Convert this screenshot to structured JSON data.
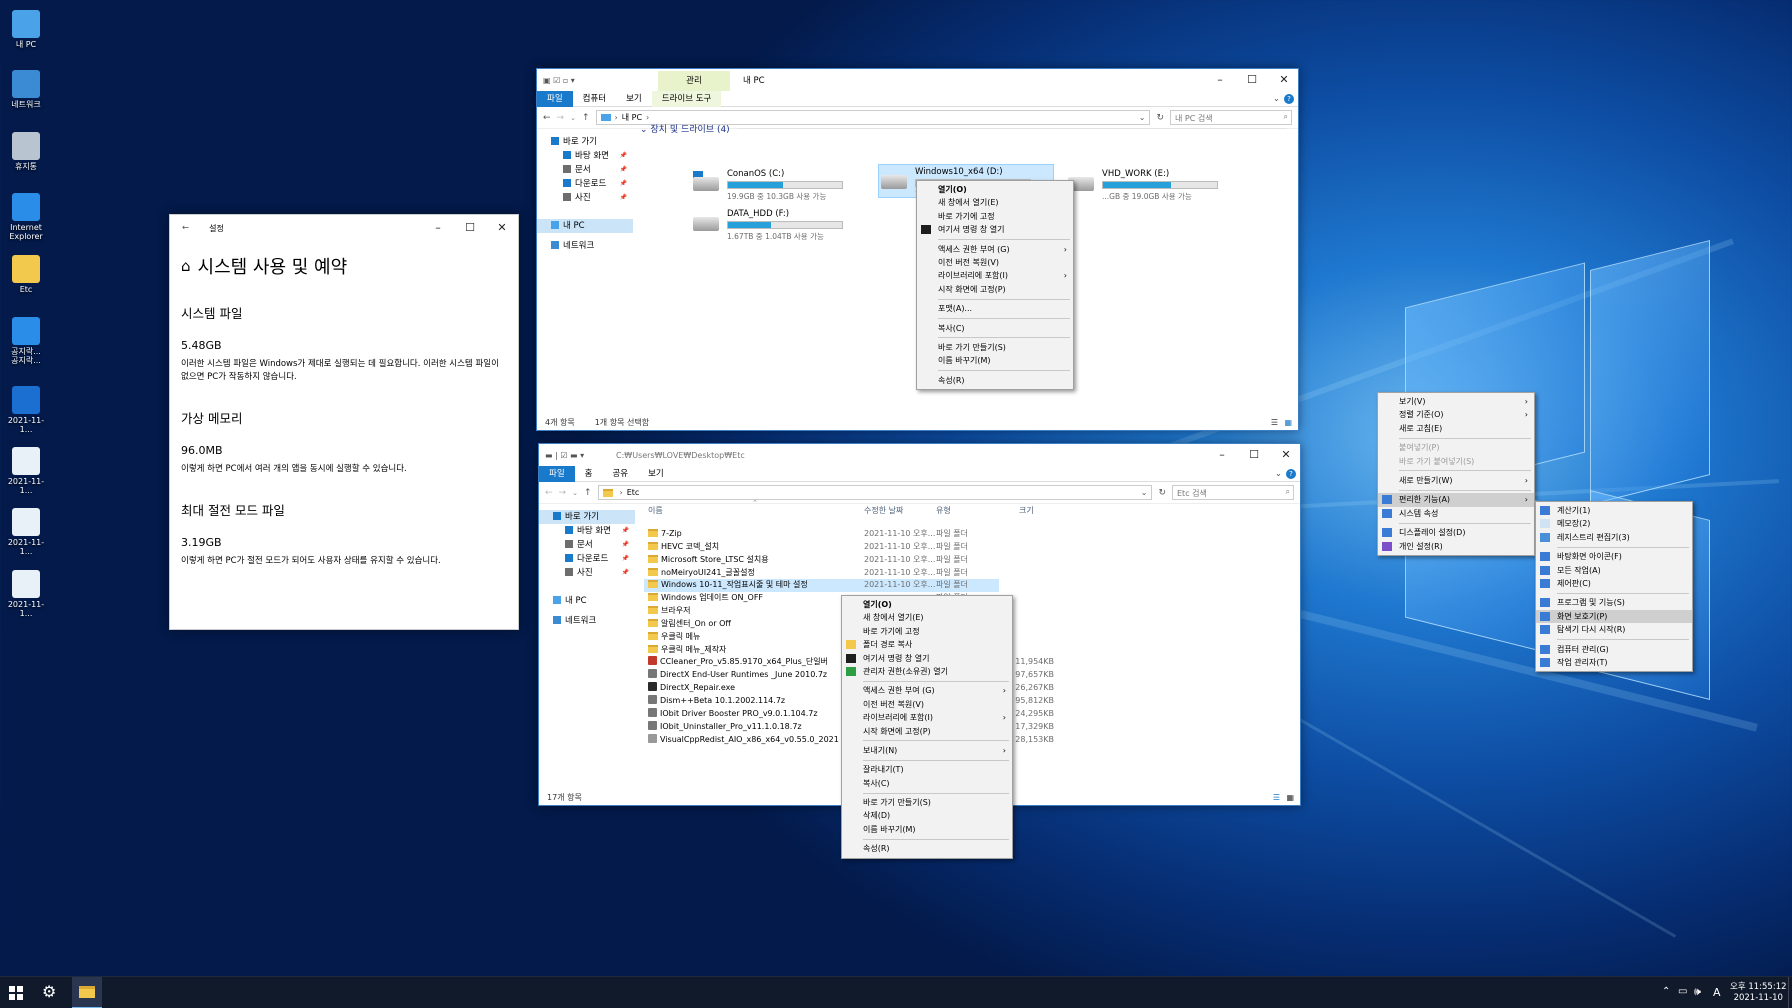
{
  "desktop": {
    "icons": [
      {
        "label": "내 PC",
        "color": "#4aa3e8"
      },
      {
        "label": "네트워크",
        "color": "#3a8ad4"
      },
      {
        "label": "휴지통",
        "color": "#b8c4d0"
      },
      {
        "label": "Internet Explorer",
        "color": "#2a8ee8"
      },
      {
        "label": "Etc",
        "color": "#f2c94c"
      },
      {
        "label": "공지락...\n공지락...",
        "color": "#2a8ee8"
      },
      {
        "label": "2021-11-1...",
        "color": "#1a6fd0"
      },
      {
        "label": "2021-11-1...",
        "color": "#e8f0f8"
      },
      {
        "label": "2021-11-1...",
        "color": "#e8f0f8"
      },
      {
        "label": "2021-11-1...",
        "color": "#e8f0f8"
      }
    ]
  },
  "settings": {
    "title": "설정",
    "heading": "시스템 사용 및 예약",
    "sections": [
      {
        "title": "시스템 파일",
        "size": "5.48GB",
        "desc": "이러한 시스템 파일은 Windows가 제대로 실행되는 데 필요합니다. 이러한 시스템 파일이 없으면 PC가 작동하지 않습니다."
      },
      {
        "title": "가상 메모리",
        "size": "96.0MB",
        "desc": "이렇게 하면 PC에서 여러 개의 앱을 동시에 실행할 수 있습니다."
      },
      {
        "title": "최대 절전 모드 파일",
        "size": "3.19GB",
        "desc": "이렇게 하면 PC가 절전 모드가 되어도 사용자 상태를 유지할 수 있습니다."
      }
    ]
  },
  "win1": {
    "title": "내 PC",
    "ctx_tab": "관리",
    "tabs": [
      "파일",
      "컴퓨터",
      "보기",
      "드라이브 도구"
    ],
    "path": "내 PC",
    "search": "내 PC 검색",
    "nav": [
      {
        "label": "바로 가기",
        "child": false,
        "pin": false
      },
      {
        "label": "바탕 화면",
        "child": true,
        "pin": true
      },
      {
        "label": "문서",
        "child": true,
        "pin": true
      },
      {
        "label": "다운로드",
        "child": true,
        "pin": true
      },
      {
        "label": "사진",
        "child": true,
        "pin": true
      },
      {
        "label": "내 PC",
        "child": false,
        "pin": false
      },
      {
        "label": "네트워크",
        "child": false,
        "pin": false
      }
    ],
    "group": "장치 및 드라이브 (4)",
    "drives": [
      {
        "name": "ConanOS (C:)",
        "size": "19.9GB 중 10.3GB 사용 가능",
        "used": 0.48
      },
      {
        "name": "Windows10_x64 (D:)",
        "size": "148GB 중 ...",
        "used": 0.6
      },
      {
        "name": "VHD_WORK (E:)",
        "size": "...GB 중 19.0GB 사용 가능",
        "used": 0.6
      },
      {
        "name": "DATA_HDD (F:)",
        "size": "1.67TB 중 1.04TB 사용 가능",
        "used": 0.38
      }
    ],
    "status_count": "4개 항목",
    "status_sel": "1개 항목 선택함"
  },
  "menu1": {
    "items": [
      {
        "t": "열기(O)",
        "b": true
      },
      {
        "t": "새 창에서 열기(E)"
      },
      {
        "t": "바로 가기에 고정"
      },
      {
        "t": "여기서 명령 창 열기",
        "icon": "cmd"
      },
      {
        "sep": true
      },
      {
        "t": "액세스 권한 부여 (G)",
        "sub": true
      },
      {
        "t": "이전 버전 복원(V)"
      },
      {
        "t": "라이브러리에 포함(I)",
        "sub": true
      },
      {
        "t": "시작 화면에 고정(P)"
      },
      {
        "sep": true
      },
      {
        "t": "포맷(A)..."
      },
      {
        "sep": true
      },
      {
        "t": "복사(C)"
      },
      {
        "sep": true
      },
      {
        "t": "바로 가기 만들기(S)"
      },
      {
        "t": "이름 바꾸기(M)"
      },
      {
        "sep": true
      },
      {
        "t": "속성(R)"
      }
    ]
  },
  "win2": {
    "path_title": "C:₩Users₩LOVE₩Desktop₩Etc",
    "tabs": [
      "파일",
      "홈",
      "공유",
      "보기"
    ],
    "path": "Etc",
    "search": "Etc 검색",
    "nav": [
      {
        "label": "바로 가기",
        "child": false,
        "pin": false
      },
      {
        "label": "바탕 화면",
        "child": true,
        "pin": true
      },
      {
        "label": "문서",
        "child": true,
        "pin": true
      },
      {
        "label": "다운로드",
        "child": true,
        "pin": true
      },
      {
        "label": "사진",
        "child": true,
        "pin": true
      },
      {
        "label": "내 PC",
        "child": false,
        "pin": false
      },
      {
        "label": "네트워크",
        "child": false,
        "pin": false
      }
    ],
    "columns": [
      "이름",
      "수정한 날짜",
      "유형",
      "크기"
    ],
    "files": [
      {
        "n": "7-Zip",
        "d": "2021-11-10 오후...",
        "t": "파일 폴더",
        "s": "",
        "k": "folder"
      },
      {
        "n": "HEVC 코덱_설치",
        "d": "2021-11-10 오후...",
        "t": "파일 폴더",
        "s": "",
        "k": "folder"
      },
      {
        "n": "Microsoft Store_LTSC 설치용",
        "d": "2021-11-10 오후...",
        "t": "파일 폴더",
        "s": "",
        "k": "folder"
      },
      {
        "n": "noMeiryoUI241_글꼴설정",
        "d": "2021-11-10 오후...",
        "t": "파일 폴더",
        "s": "",
        "k": "folder"
      },
      {
        "n": "Windows 10-11_작업표시줄 및 테마 설정",
        "d": "2021-11-10 오후...",
        "t": "파일 폴더",
        "s": "",
        "k": "folder",
        "sel": true
      },
      {
        "n": "Windows 업데이트 ON_OFF",
        "d": "",
        "t": "파일 폴더",
        "s": "",
        "k": "folder"
      },
      {
        "n": "브라우저",
        "d": "",
        "t": "파일 폴더",
        "s": "",
        "k": "folder"
      },
      {
        "n": "알림센터_On or Off",
        "d": "",
        "t": "파일 폴더",
        "s": "",
        "k": "folder"
      },
      {
        "n": "우클릭 메뉴",
        "d": "",
        "t": "파일 폴더",
        "s": "",
        "k": "folder"
      },
      {
        "n": "우클릭 메뉴_제작자",
        "d": "",
        "t": "파일 폴더",
        "s": "",
        "k": "folder"
      },
      {
        "n": "CCleaner_Pro_v5.85.9170_x64_Plus_단일버",
        "d": "",
        "t": "프로그램",
        "s": "11,954KB",
        "k": "ccl"
      },
      {
        "n": "DirectX End-User Runtimes _June 2010.7z",
        "d": "",
        "t": "일",
        "s": "97,657KB",
        "k": "7z"
      },
      {
        "n": "DirectX_Repair.exe",
        "d": "",
        "t": "프로그램",
        "s": "26,267KB",
        "k": "dx"
      },
      {
        "n": "Dism++Beta 10.1.2002.114.7z",
        "d": "",
        "t": "일",
        "s": "95,812KB",
        "k": "7z"
      },
      {
        "n": "IObit Driver Booster PRO_v9.0.1.104.7z",
        "d": "",
        "t": "일",
        "s": "24,295KB",
        "k": "7z"
      },
      {
        "n": "IObit_Uninstaller_Pro_v11.1.0.18.7z",
        "d": "",
        "t": "일",
        "s": "17,329KB",
        "k": "7z"
      },
      {
        "n": "VisualCppRedist_AIO_x86_x64_v0.55.0_2021",
        "d": "",
        "t": "프로그램",
        "s": "28,153KB",
        "k": "exe"
      }
    ],
    "status_count": "17개 항목"
  },
  "menu2": {
    "items": [
      {
        "t": "열기(O)",
        "b": true
      },
      {
        "t": "새 창에서 열기(E)"
      },
      {
        "t": "바로 가기에 고정"
      },
      {
        "t": "폴더 경로 복사",
        "icon": "folder"
      },
      {
        "t": "여기서 명령 창 열기",
        "icon": "cmd"
      },
      {
        "t": "관리자 권한(소유권) 열기",
        "icon": "shield"
      },
      {
        "sep": true
      },
      {
        "t": "액세스 권한 부여 (G)",
        "sub": true
      },
      {
        "t": "이전 버전 복원(V)"
      },
      {
        "t": "라이브러리에 포함(I)",
        "sub": true
      },
      {
        "t": "시작 화면에 고정(P)"
      },
      {
        "sep": true
      },
      {
        "t": "보내기(N)",
        "sub": true
      },
      {
        "sep": true
      },
      {
        "t": "잘라내기(T)"
      },
      {
        "t": "복사(C)"
      },
      {
        "sep": true
      },
      {
        "t": "바로 가기 만들기(S)"
      },
      {
        "t": "삭제(D)"
      },
      {
        "t": "이름 바꾸기(M)"
      },
      {
        "sep": true
      },
      {
        "t": "속성(R)"
      }
    ]
  },
  "menu3": {
    "items": [
      {
        "t": "보기(V)",
        "sub": true
      },
      {
        "t": "정렬 기준(O)",
        "sub": true
      },
      {
        "t": "새로 고침(E)"
      },
      {
        "sep": true
      },
      {
        "t": "붙여넣기(P)",
        "dis": true
      },
      {
        "t": "바로 가기 붙여넣기(S)",
        "dis": true
      },
      {
        "sep": true
      },
      {
        "t": "새로 만들기(W)",
        "sub": true
      },
      {
        "sep": true
      },
      {
        "t": "편리한 기능(A)",
        "sub": true,
        "icon": "app",
        "hl": true
      },
      {
        "t": "시스템 속성",
        "icon": "app"
      },
      {
        "sep": true
      },
      {
        "t": "디스플레이 설정(D)",
        "icon": "disp"
      },
      {
        "t": "개인 설정(R)",
        "icon": "pers"
      }
    ]
  },
  "menu4": {
    "items": [
      {
        "t": "계산기(1)",
        "icon": "app"
      },
      {
        "t": "메모장(2)",
        "icon": "note"
      },
      {
        "t": "레지스트리 편집기(3)",
        "icon": "reg"
      },
      {
        "sep": true
      },
      {
        "t": "바탕화면 아이콘(F)",
        "icon": "app"
      },
      {
        "t": "모든 작업(A)",
        "icon": "app"
      },
      {
        "t": "제어판(C)",
        "icon": "app"
      },
      {
        "sep": true
      },
      {
        "t": "프로그램 및 기능(S)",
        "icon": "app"
      },
      {
        "t": "화면 보호기(P)",
        "icon": "app",
        "hl": true
      },
      {
        "t": "탐색기 다시 시작(R)",
        "icon": "app"
      },
      {
        "sep": true
      },
      {
        "t": "컴퓨터 관리(G)",
        "icon": "app"
      },
      {
        "t": "작업 관리자(T)",
        "icon": "app"
      }
    ]
  },
  "taskbar": {
    "time": "오후 11:55:12",
    "date": "2021-11-10",
    "lang": "A"
  }
}
